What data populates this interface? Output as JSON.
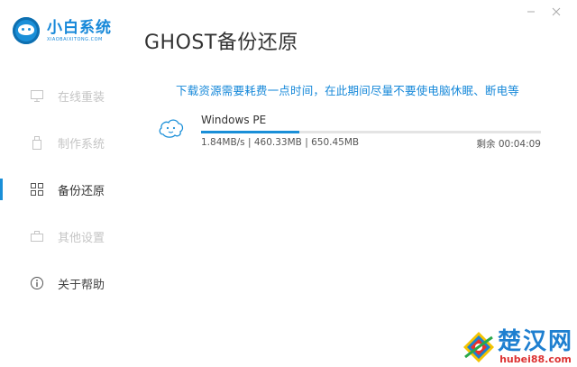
{
  "app": {
    "logo_title": "小白系统",
    "logo_sub": "XIAOBAIXITONG.COM",
    "page_title": "GHOST备份还原"
  },
  "sidebar": {
    "items": [
      {
        "label": "在线重装",
        "icon": "monitor-icon",
        "state": "disabled"
      },
      {
        "label": "制作系统",
        "icon": "usb-icon",
        "state": "disabled"
      },
      {
        "label": "备份还原",
        "icon": "grid-icon",
        "state": "active"
      },
      {
        "label": "其他设置",
        "icon": "briefcase-icon",
        "state": "disabled"
      },
      {
        "label": "关于帮助",
        "icon": "info-icon",
        "state": "normal"
      }
    ]
  },
  "main": {
    "notice": "下载资源需要耗费一点时间，在此期间尽量不要使电脑休眠、断电等",
    "task": {
      "name": "Windows PE",
      "speed": "1.84MB/s",
      "downloaded": "460.33MB",
      "total": "650.45MB",
      "remaining_label": "剩余",
      "remaining_time": "00:04:09",
      "progress_fraction": 0.29
    }
  },
  "watermark": {
    "title": "楚汉网",
    "sub": "hubei88.com"
  },
  "colors": {
    "accent": "#1a8fd8",
    "watermark_red": "#d33"
  }
}
